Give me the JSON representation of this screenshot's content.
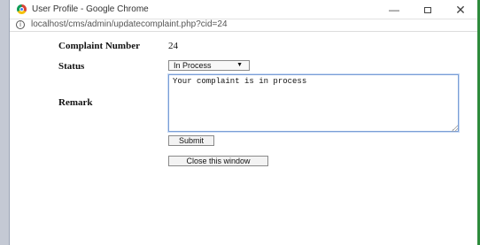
{
  "window": {
    "title": "User Profile - Google Chrome",
    "controls": {
      "minimize": "—",
      "close": "✕"
    }
  },
  "address_bar": {
    "url": "localhost/cms/admin/updatecomplaint.php?cid=24",
    "info_glyph": "i"
  },
  "form": {
    "complaint_number_label": "Complaint Number",
    "complaint_number_value": "24",
    "status_label": "Status",
    "status_selected": "In Process",
    "status_arrow": "▼",
    "remark_label": "Remark",
    "remark_value": "Your complaint is in process",
    "submit_label": "Submit",
    "close_label": "Close this window"
  },
  "colors": {
    "focus_border": "#7a9ed6",
    "right_edge": "#2e8b3c"
  }
}
